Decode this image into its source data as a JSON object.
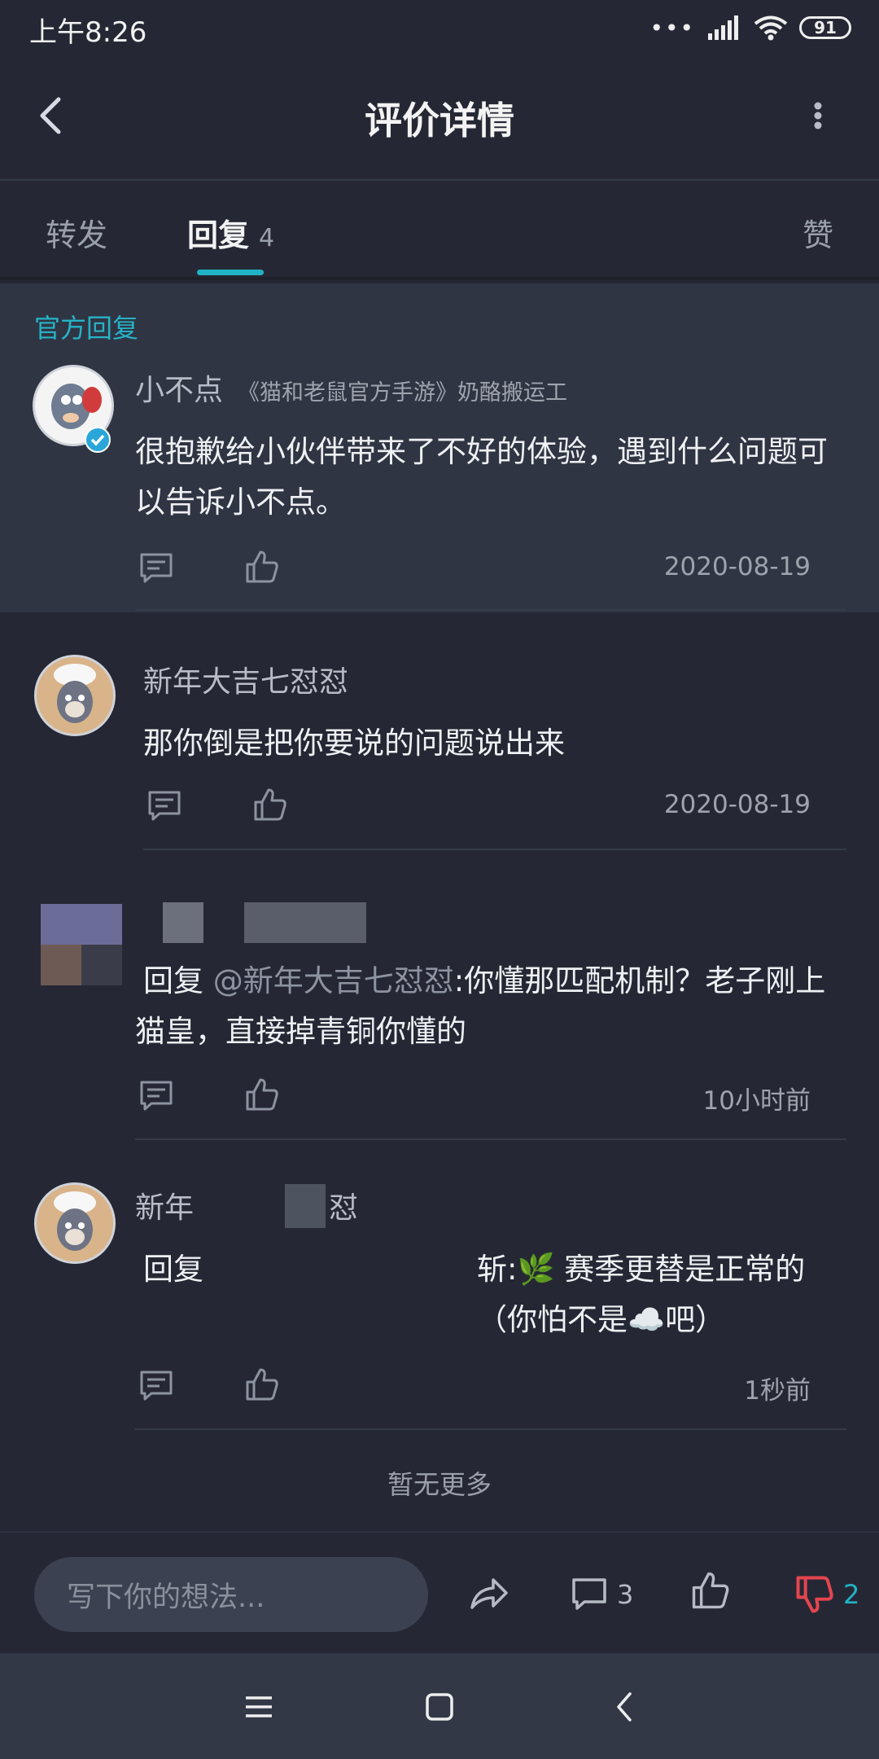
{
  "status_bar": {
    "time": "上午8:26",
    "battery": "91",
    "signal_icon": "signal-icon",
    "wifi_icon": "wifi-icon"
  },
  "header": {
    "title": "评价详情",
    "back_icon": "chevron-left-icon",
    "more_icon": "more-vertical-icon"
  },
  "tabs": [
    {
      "label": "转发",
      "active": false
    },
    {
      "label": "回复",
      "count": "4",
      "active": true
    },
    {
      "label": "赞",
      "active": false
    }
  ],
  "official": {
    "label": "官方回复",
    "username": "小不点",
    "title": "《猫和老鼠官方手游》奶酪搬运工",
    "text": "很抱歉给小伙伴带来了不好的体验，遇到什么问题可以告诉小不点。",
    "date": "2020-08-19"
  },
  "comments": [
    {
      "username": "新年大吉七怼怼",
      "text": "那你倒是把你要说的问题说出来",
      "date": "2020-08-19"
    },
    {
      "username": "",
      "reply_prefix": "回复 ",
      "mention": "@新年大吉七怼怼",
      "text": ":你懂那匹配机制？老子刚上猫皇，直接掉青铜你懂的",
      "date": "10小时前"
    },
    {
      "username": "新年",
      "username_tail": "怼",
      "reply_prefix": "回复",
      "text_tail": "斩:🌿 赛季更替是正常的（你怕不是☁️吧）",
      "date": "1秒前"
    }
  ],
  "footer": {
    "no_more": "暂无更多"
  },
  "bottom_bar": {
    "input_placeholder": "写下你的想法...",
    "comment_count": "3",
    "dislike_count": "2"
  },
  "colors": {
    "accent": "#21b3c5",
    "dislike": "#e5454f",
    "background": "#252834"
  }
}
